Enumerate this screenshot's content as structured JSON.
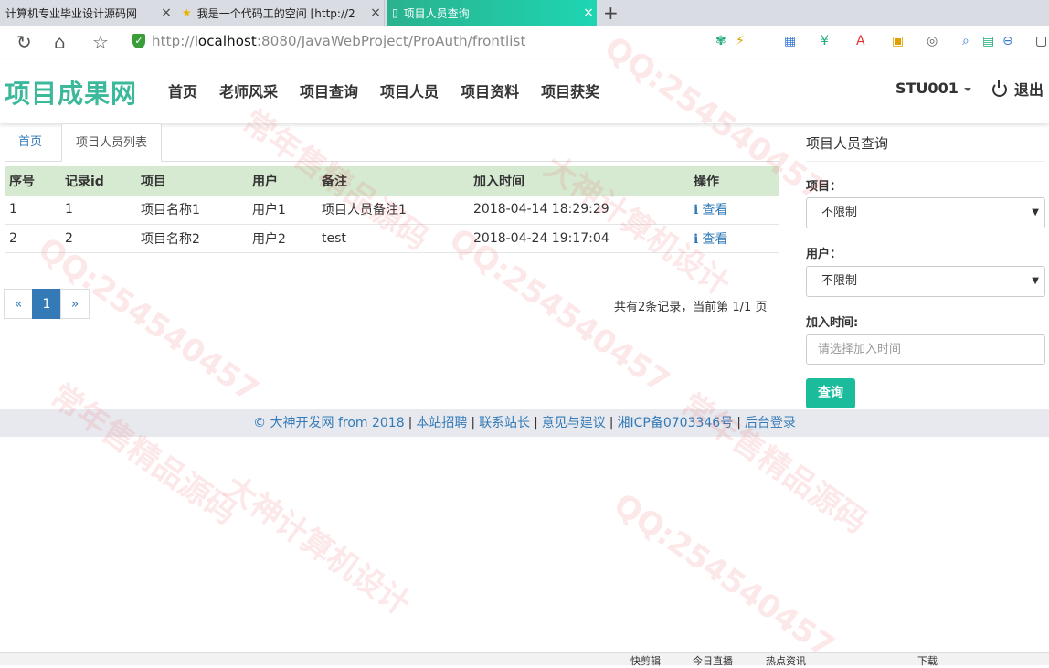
{
  "browser": {
    "tabs": [
      {
        "title": "计算机专业毕业设计源码网",
        "close": "×"
      },
      {
        "title": "我是一个代码工的空间 [http://2",
        "close": "×"
      },
      {
        "title": "项目人员查询",
        "close": "×"
      }
    ],
    "new_tab": "+",
    "url_prefix": "http://",
    "url_host": "localhost",
    "url_rest": ":8080/JavaWebProject/ProAuth/frontlist"
  },
  "header": {
    "brand": "项目成果网",
    "menu": [
      "首页",
      "老师风采",
      "项目查询",
      "项目人员",
      "项目资料",
      "项目获奖"
    ],
    "user": "STU001",
    "logout": "退出"
  },
  "content_tabs": {
    "home": "首页",
    "active": "项目人员列表"
  },
  "table": {
    "columns": [
      "序号",
      "记录id",
      "项目",
      "用户",
      "备注",
      "加入时间",
      "操作"
    ],
    "rows": [
      {
        "no": "1",
        "id": "1",
        "project": "项目名称1",
        "user": "用户1",
        "note": "项目人员备注1",
        "time": "2018-04-14 18:29:29",
        "action": "查看"
      },
      {
        "no": "2",
        "id": "2",
        "project": "项目名称2",
        "user": "用户2",
        "note": "test",
        "time": "2018-04-24 19:17:04",
        "action": "查看"
      }
    ]
  },
  "pager": {
    "prev": "«",
    "current": "1",
    "next": "»",
    "info": "共有2条记录，当前第 1/1 页"
  },
  "sidebar": {
    "title": "项目人员查询",
    "project_label": "项目：",
    "project_value": "不限制",
    "user_label": "用户：",
    "user_value": "不限制",
    "time_label": "加入时间:",
    "time_placeholder": "请选择加入时间",
    "query": "查询"
  },
  "footer": {
    "copyright": "© 大神开发网 from 2018",
    "links": [
      "本站招聘",
      "联系站长",
      "意见与建议",
      "湘ICP备0703346号",
      "后台登录"
    ]
  },
  "watermarks": [
    "大神计算机设计",
    "QQ:254540457",
    "常年售精品源码"
  ],
  "statusbar": [
    "快剪辑",
    "今日直播",
    "热点资讯",
    "下载"
  ]
}
